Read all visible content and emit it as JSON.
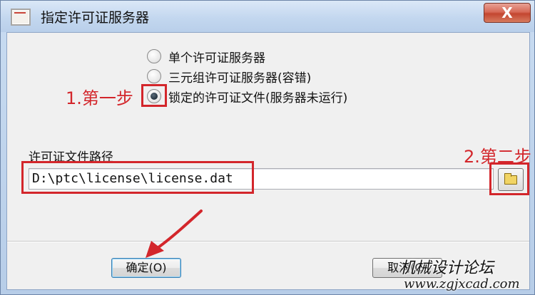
{
  "window": {
    "title": "指定许可证服务器",
    "close_label": "X"
  },
  "options": [
    {
      "label": "单个许可证服务器",
      "checked": false
    },
    {
      "label": "三元组许可证服务器(容错)",
      "checked": false
    },
    {
      "label": "锁定的许可证文件(服务器未运行)",
      "checked": true
    }
  ],
  "path": {
    "label": "许可证文件路径",
    "value": "D:\\ptc\\license\\license.dat"
  },
  "icons": {
    "browse": "folder-icon",
    "window": "app-icon"
  },
  "buttons": {
    "ok_label": "确定(O)",
    "cancel_label": "取消(C)"
  },
  "annotations": {
    "step1": "1.第一步",
    "step2": "2.第二步"
  },
  "watermark": {
    "title": "机械设计论坛",
    "url": "www.zgjxcad.com"
  },
  "colors": {
    "annotation_red": "#d3262b",
    "titlebar": "#c3d7ef",
    "close_button": "#c34630"
  }
}
